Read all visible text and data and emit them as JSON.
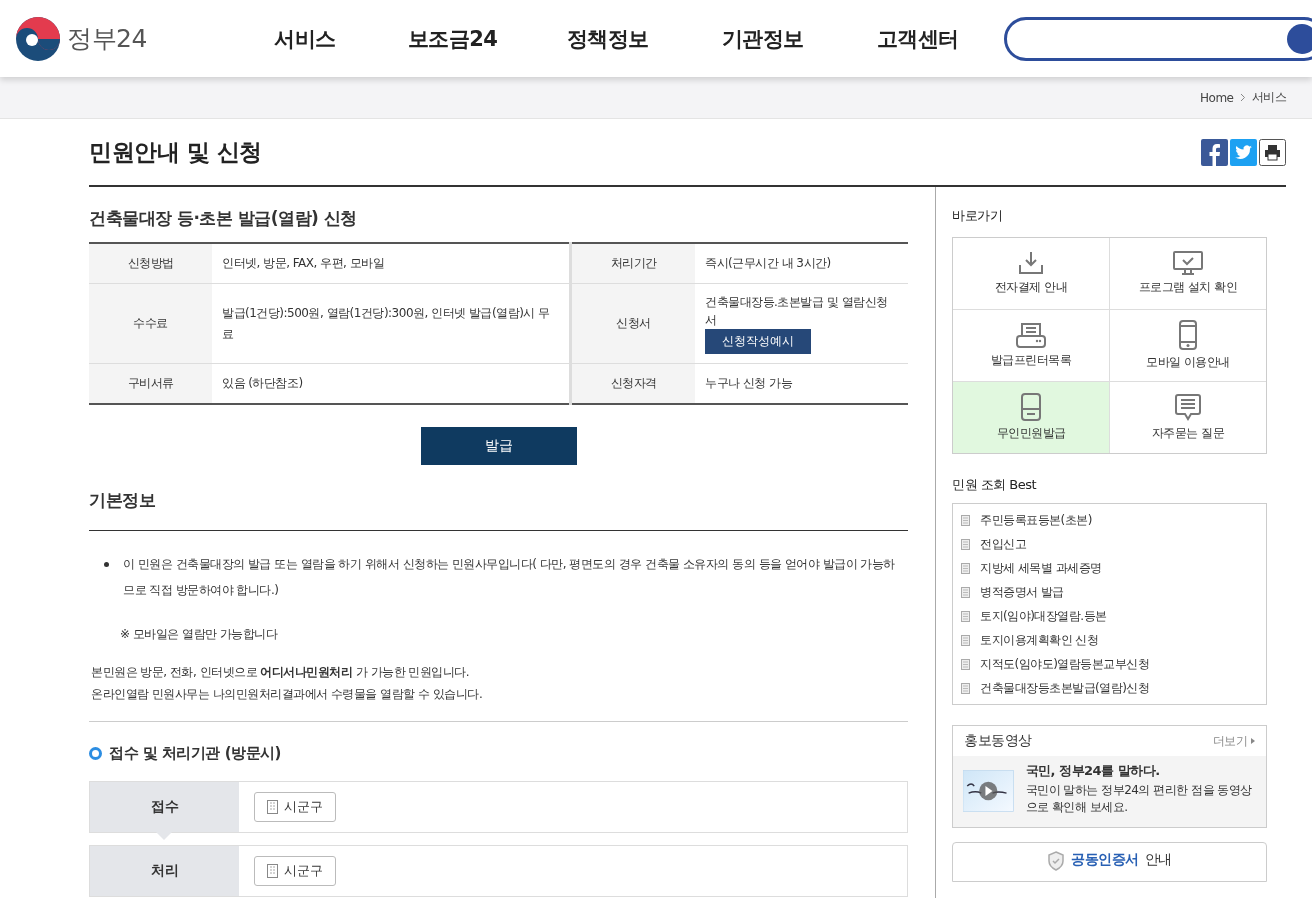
{
  "header": {
    "logo": "정부24",
    "nav": [
      "서비스",
      "보조금24",
      "정책정보",
      "기관정보",
      "고객센터"
    ]
  },
  "breadcrumb": [
    "Home",
    "서비스"
  ],
  "page_title": "민원안내 및 신청",
  "service": {
    "title": "건축물대장 등·초본 발급(열람) 신청",
    "rows": [
      {
        "label_1": "신청방법",
        "value_1": "인터넷, 방문, FAX, 우편, 모바일",
        "label_2": "처리기간",
        "value_2": "즉시(근무시간 내 3시간)"
      },
      {
        "label_1": "수수료",
        "value_1": "발급(1건당):500원, 열람(1건당):300원, 인터넷 발급(열람)시 무료",
        "label_2": "신청서",
        "value_2": "건축물대장등.초본발급 및 열람신청서",
        "button": "신청작성예시"
      },
      {
        "label_1": "구비서류",
        "value_1": "있음 (하단참조)",
        "label_2": "신청자격",
        "value_2": "누구나 신청 가능"
      }
    ],
    "issue_button": "발급"
  },
  "basic_info": {
    "title": "기본정보",
    "bullet": "이 민원은 건축물대장의 발급 또는 열람을 하기 위해서 신청하는 민원사무입니다( 다만, 평면도의 경우 건축물 소유자의 동의 등을 얻어야 발급이 가능하므로 직접 방문하여야 합니다.)",
    "note": "※ 모바일은 열람만 가능합니다",
    "lines": [
      "본민원은 방문, 전화, 인터넷으로 **어디서나민원처리** 가 가능한 민원입니다.",
      "온라인열람 민원사무는 나의민원처리결과에서 수령물을 열람할 수 있습니다."
    ]
  },
  "agency": {
    "title": "접수 및 처리기관 (방문시)",
    "rows": [
      {
        "label": "접수",
        "office": "시군구"
      },
      {
        "label": "처리",
        "office": "시군구"
      }
    ]
  },
  "shortcuts": {
    "title": "바로가기",
    "items": [
      {
        "label": "전자결제 안내",
        "selected": false
      },
      {
        "label": "프로그램 설치 확인",
        "selected": false
      },
      {
        "label": "발급프린터목록",
        "selected": false
      },
      {
        "label": "모바일 이용안내",
        "selected": false
      },
      {
        "label": "무인민원발급",
        "selected": true
      },
      {
        "label": "자주묻는 질문",
        "selected": false
      }
    ]
  },
  "best": {
    "title": "민원 조회 Best",
    "items": [
      "주민등록표등본(초본)",
      "전입신고",
      "지방세 세목별 과세증명",
      "병적증명서 발급",
      "토지(임야)대장열람.등본",
      "토지이용계획확인 신청",
      "지적도(임야도)열람등본교부신청",
      "건축물대장등초본발급(열람)신청"
    ]
  },
  "video": {
    "title": "홍보동영상",
    "more": "더보기",
    "headline": "국민, 정부24를 말하다.",
    "description": "국민이 말하는 정부24의 편리한 점을 동영상으로 확인해 보세요."
  },
  "certificate": {
    "link": "공동인증서",
    "suffix": "안내"
  }
}
